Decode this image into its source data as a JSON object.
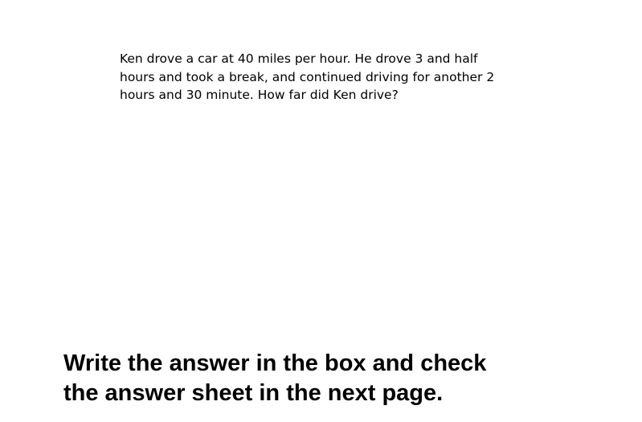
{
  "problem": {
    "lines": [
      "Ken drove a car at 40 miles per hour. He drove 3 and half",
      "hours and took a break, and continued driving for another 2",
      "hours and 30 minute. How far did Ken drive?"
    ]
  },
  "instruction": {
    "lines": [
      "Write the answer in the box and check",
      "the answer sheet in the next page."
    ]
  }
}
